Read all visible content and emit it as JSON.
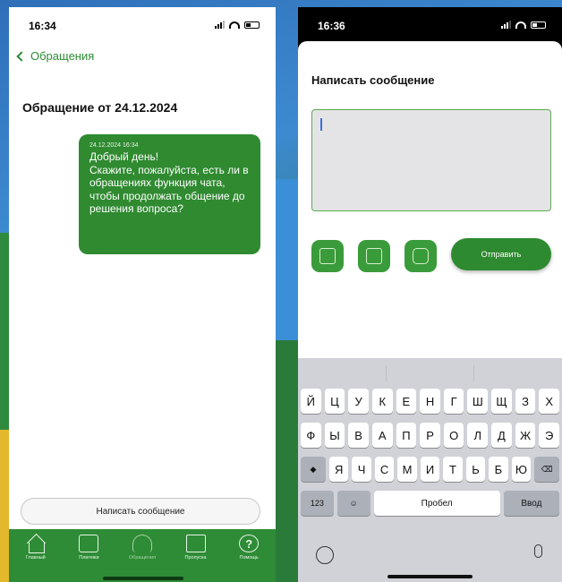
{
  "left": {
    "status": {
      "time": "16:34"
    },
    "back_label": "Обращения",
    "title": "Обращение от 24.12.2024",
    "message": {
      "timestamp": "24.12.2024 16:34",
      "text": "Добрый день!\nСкажите, пожалуйста, есть ли в обращениях функция чата, чтобы продолжать общение до решения вопроса?"
    },
    "write_button": "Написать сообщение",
    "tabs": [
      {
        "label": "Главный",
        "icon": "home-icon"
      },
      {
        "label": "Платежи",
        "icon": "wallet-icon"
      },
      {
        "label": "Обращения",
        "icon": "headset-icon"
      },
      {
        "label": "Пропуска",
        "icon": "pass-icon"
      },
      {
        "label": "Помощь",
        "icon": "help-icon"
      }
    ],
    "active_tab": "Обращения",
    "accent_color": "#2e8b36"
  },
  "right": {
    "status": {
      "time": "16:36"
    },
    "sheet_title": "Написать сообщение",
    "message_input": {
      "value": "",
      "placeholder": ""
    },
    "attach_buttons": [
      "add-file-icon",
      "gallery-icon",
      "camera-icon"
    ],
    "send_button": "Отправить",
    "keyboard": {
      "row1": [
        "Й",
        "Ц",
        "У",
        "К",
        "Е",
        "Н",
        "Г",
        "Ш",
        "Щ",
        "З",
        "Х"
      ],
      "row2": [
        "Ф",
        "Ы",
        "В",
        "А",
        "П",
        "Р",
        "О",
        "Л",
        "Д",
        "Ж",
        "Э"
      ],
      "row3": [
        "Я",
        "Ч",
        "С",
        "М",
        "И",
        "Т",
        "Ь",
        "Б",
        "Ю"
      ],
      "numbers_key": "123",
      "space_key": "Пробел",
      "return_key": "Ввод"
    }
  },
  "help_icon_glyph": "?"
}
